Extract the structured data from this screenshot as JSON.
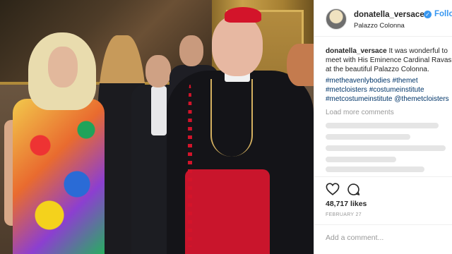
{
  "post": {
    "username": "donatella_versace",
    "verified_icon": "verified-badge-icon",
    "follow_label": "Follow",
    "location": "Palazzo Colonna",
    "caption": {
      "user": "donatella_versace",
      "text": "It was wonderful to meet with His Eminence Cardinal Ravasi at the beautiful Palazzo Colonna."
    },
    "hashtags": [
      "#metheavenlybodies",
      "#themet",
      "#metcloisters",
      "#costumeinstitute",
      "#metcostumeinstitute",
      "@themetcloisters"
    ],
    "load_more": "Load more comments",
    "likes": "48,717 likes",
    "date": "FEBRUARY 27",
    "add_comment_placeholder": "Add a comment...",
    "icons": {
      "like": "heart-outline-icon",
      "comment": "speech-bubble-icon"
    }
  },
  "colors": {
    "link": "#003569",
    "accent": "#3897f0",
    "text": "#262626",
    "muted": "#999999",
    "cardinal_red": "#d3142a"
  }
}
